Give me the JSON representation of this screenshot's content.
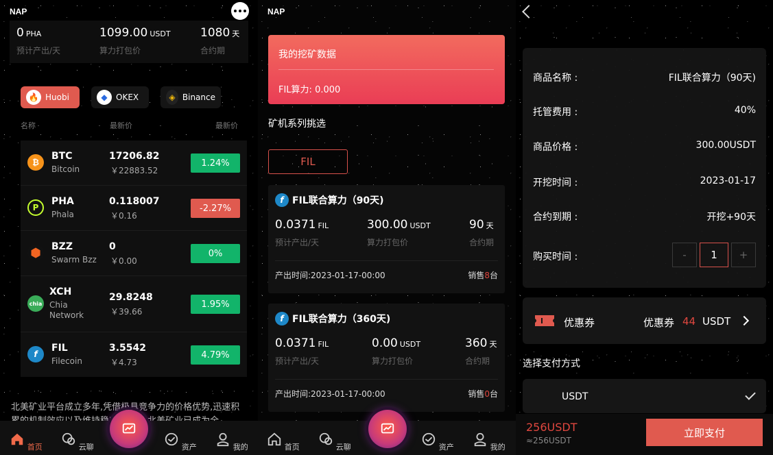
{
  "home": {
    "brand": "NAP",
    "stats": [
      {
        "value": "0",
        "unit": "PHA",
        "label": "预计产出/天"
      },
      {
        "value": "1099.00",
        "unit": "USDT",
        "label": "算力打包价"
      },
      {
        "value": "1080",
        "unit": "天",
        "label": "合约期"
      }
    ],
    "exchanges": [
      {
        "label": "Huobi",
        "icon": "huobi-flame-icon"
      },
      {
        "label": "OKEX",
        "icon": "okex-icon"
      },
      {
        "label": "Binance",
        "icon": "binance-icon"
      }
    ],
    "table_headers": [
      "名称",
      "最新价",
      "最新价"
    ],
    "coins": [
      {
        "symbol": "BTC",
        "name": "Bitcoin",
        "price": "17206.82",
        "cny": "￥22883.52",
        "change": "1.24%",
        "color": "#f7931a",
        "glyph": "₿",
        "up": true
      },
      {
        "symbol": "PHA",
        "name": "Phala",
        "price": "0.118007",
        "cny": "￥0.16",
        "change": "-2.27%",
        "color": "#c5ff2e",
        "glyph": "P",
        "up": false
      },
      {
        "symbol": "BZZ",
        "name": "Swarm Bzz",
        "price": "0",
        "cny": "￥0.00",
        "change": "0%",
        "color": "#f26522",
        "glyph": "⬢",
        "up": true
      },
      {
        "symbol": "XCH",
        "name": "Chia Network",
        "price": "29.8248",
        "cny": "￥39.66",
        "change": "1.95%",
        "color": "#3aac59",
        "glyph": "chia",
        "up": true
      },
      {
        "symbol": "FIL",
        "name": "Filecoin",
        "price": "3.5542",
        "cny": "￥4.73",
        "change": "4.79%",
        "color": "#1e88c8",
        "glyph": "f",
        "up": true
      }
    ],
    "intro": "北美矿业平台成立多年,凭借极具竞争力的价格优势,迅速积累的机制效应以及维持稳定的运营,北美矿业已成为全",
    "tabs": [
      "首页",
      "云聊",
      "资产",
      "我的"
    ]
  },
  "mining": {
    "brand": "NAP",
    "card_title": "我的挖矿数据",
    "card_sub": "FIL算力: 0.000",
    "section_title": "矿机系列挑选",
    "filter": "FIL",
    "products": [
      {
        "name": "FIL联合算力（90天)",
        "out": "0.0371",
        "out_unit": "FIL",
        "price": "300.00",
        "price_unit": "USDT",
        "days": "90",
        "days_unit": "天",
        "out_label": "预计产出/天",
        "price_label": "算力打包价",
        "days_label": "合约期",
        "time": "产出时间:2023-01-17-00:00",
        "sold_prefix": "销售",
        "sold": "8",
        "sold_suffix": "台"
      },
      {
        "name": "FIL联合算力（360天)",
        "out": "0.0371",
        "out_unit": "FIL",
        "price": "0.00",
        "price_unit": "USDT",
        "days": "360",
        "days_unit": "天",
        "out_label": "预计产出/天",
        "price_label": "算力打包价",
        "days_label": "合约期",
        "time": "产出时间:2023-01-17-00:00",
        "sold_prefix": "销售",
        "sold": "0",
        "sold_suffix": "台"
      }
    ],
    "tabs": [
      "首页",
      "云聊",
      "资产",
      "我的"
    ]
  },
  "order": {
    "rows": [
      {
        "label": "商品名称 :",
        "value": "FIL联合算力（90天)"
      },
      {
        "label": "托管费用 :",
        "value": "40%"
      },
      {
        "label": "商品价格 :",
        "value": "300.00USDT"
      },
      {
        "label": "开挖时间 :",
        "value": "2023-01-17"
      },
      {
        "label": "合约到期 :",
        "value": "开挖+90天"
      }
    ],
    "buy_time_label": "购买时间 :",
    "minus": "-",
    "qty": "1",
    "plus": "+",
    "coupon_label": "优惠券",
    "coupon_right_label": "优惠券",
    "coupon_amount": "44",
    "coupon_unit": "USDT",
    "pay_method_title": "选择支付方式",
    "pay_option": "USDT",
    "total": "256USDT",
    "total_sub": "≈256USDT",
    "pay_button": "立即支付"
  }
}
